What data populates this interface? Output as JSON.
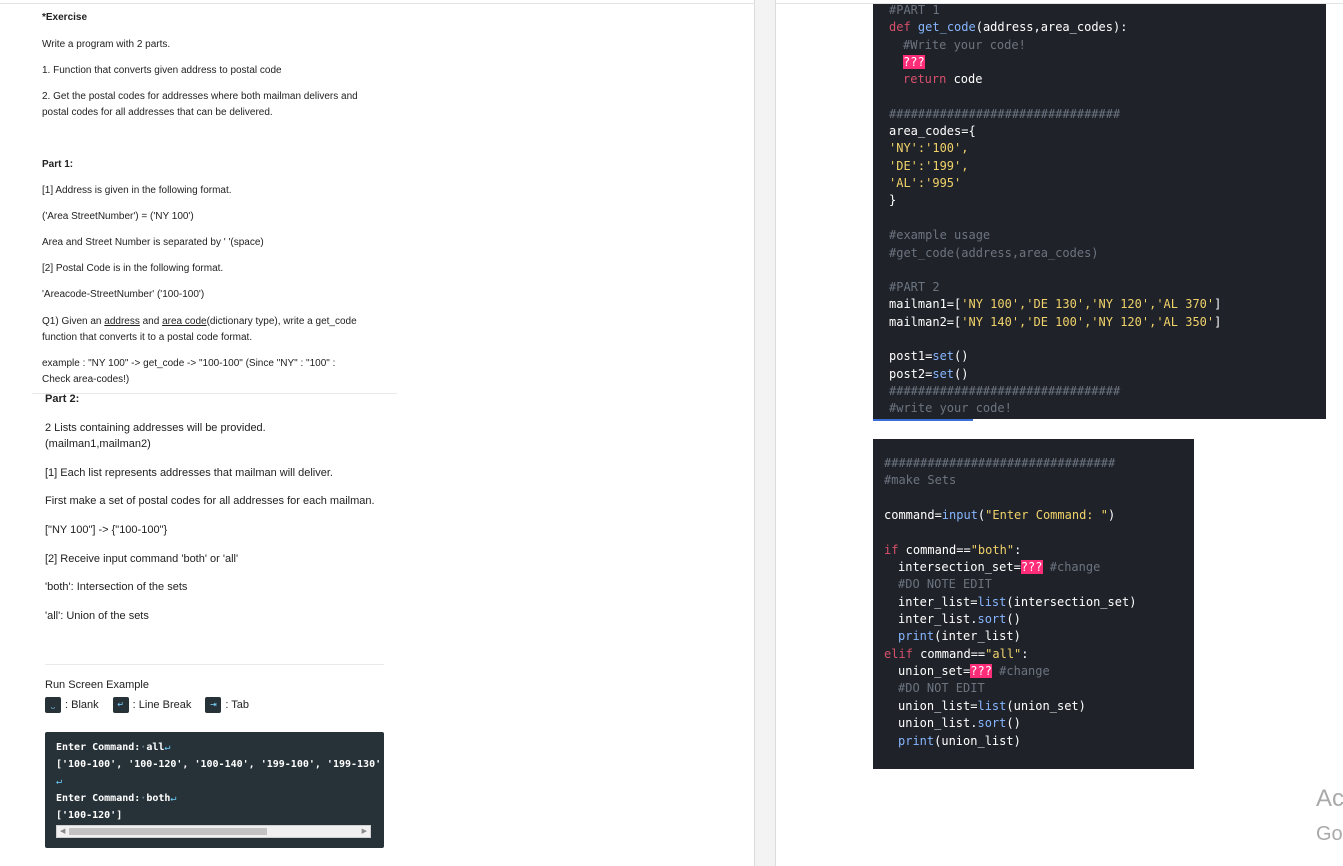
{
  "exercise": {
    "title": "*Exercise",
    "intro": "Write a program with 2 parts.",
    "item1": "1. Function that converts given address to postal code",
    "item2_a": "2. Get the postal codes for addresses where both mailman delivers and",
    "item2_b": "postal codes for all addresses that can be delivered."
  },
  "part1": {
    "heading": "Part 1:",
    "l1": "[1] Address is given in the following format.",
    "l2": "('Area StreetNumber') = ('NY 100')",
    "l3": "Area and Street Number is separated by ' '(space)",
    "l4": "[2] Postal Code is in the following format.",
    "l5": "'Areacode-StreetNumber' ('100-100')",
    "q_pre": "Q1) Given an ",
    "q_address": "address",
    "q_and": " and ",
    "q_area": "area code",
    "q_post": "(dictionary type), write a get_code",
    "q_line2": "function that converts it to a postal code format.",
    "ex_line1": "example : \"NY 100\" -> get_code -> \"100-100\" (Since \"NY\" : \"100\"    :",
    "ex_line2": "Check area-codes!)"
  },
  "part2": {
    "heading": "Part 2:",
    "l1": "2 Lists containing addresses will be provided.",
    "l2": "(mailman1,mailman2)",
    "l3": "[1] Each list represents addresses that mailman will deliver.",
    "l4": "First make a set of postal codes for all addresses for each mailman.",
    "l5": "[\"NY 100\"] -> {\"100-100\"}",
    "l6": "[2] Receive input command  'both' or 'all'",
    "l7": "'both': Intersection of the sets",
    "l8": "'all': Union of the sets"
  },
  "run": {
    "title": "Run Screen Example",
    "legend_blank": ": Blank",
    "legend_break": ": Line Break",
    "legend_tab": ": Tab",
    "t1_label": "Enter Command:",
    "t1_value": "all",
    "t2": "['100-100', '100-120', '100-140', '199-100', '199-130'",
    "t3_label": "Enter Command:",
    "t3_value": "both",
    "t4": "['100-120']"
  },
  "code1": {
    "l0": "#PART 1",
    "l1_def": "def",
    "l1_fn": "get_code",
    "l1_rest": "(address,area_codes):",
    "l2": "#Write your code!",
    "l3": "???",
    "l4_kw": "return",
    "l4_rest": " code",
    "l6": "################################",
    "l7": "area_codes={",
    "l8": "'NY':'100',",
    "l9": "'DE':'199',",
    "l10": "'AL':'995'",
    "l11": "}",
    "l13": "#example usage",
    "l14": "#get_code(address,area_codes)",
    "l16": "#PART 2",
    "l17_name": "mailman1=[",
    "l17_vals": "'NY 100','DE 130','NY 120','AL 370'",
    "l17_end": "]",
    "l18_name": "mailman2=[",
    "l18_vals": "'NY 140','DE 100','NY 120','AL 350'",
    "l18_end": "]",
    "l20_name": "post1=",
    "l20_fn": "set",
    "l20_end": "()",
    "l21_name": "post2=",
    "l21_fn": "set",
    "l21_end": "()",
    "l22": "################################",
    "l23": "#write your code!"
  },
  "code2": {
    "l0": "################################",
    "l1": "#make Sets",
    "l3_name": "command=",
    "l3_fn": "input",
    "l3_open": "(",
    "l3_str": "\"Enter Command: \"",
    "l3_close": ")",
    "l5_kw": "if",
    "l5_mid": " command==",
    "l5_str": "\"both\"",
    "l5_end": ":",
    "l6_name": "intersection_set=",
    "l6_hl": "???",
    "l6_c": " #change",
    "l7": "#DO NOTE EDIT",
    "l8_name": "inter_list=",
    "l8_fn": "list",
    "l8_rest": "(intersection_set)",
    "l9_name": "inter_list.",
    "l9_fn": "sort",
    "l9_rest": "()",
    "l10_fn": "print",
    "l10_rest": "(inter_list)",
    "l11_kw": "elif",
    "l11_mid": " command==",
    "l11_str": "\"all\"",
    "l11_end": ":",
    "l12_name": "union_set=",
    "l12_hl": "???",
    "l12_c": " #change",
    "l13": "#DO NOT EDIT",
    "l14_name": "union_list=",
    "l14_fn": "list",
    "l14_rest": "(union_set)",
    "l15_name": "union_list.",
    "l15_fn": "sort",
    "l15_rest": "()",
    "l16_fn": "print",
    "l16_rest": "(union_list)"
  },
  "edge": {
    "a": "Ac",
    "b": "Go"
  }
}
